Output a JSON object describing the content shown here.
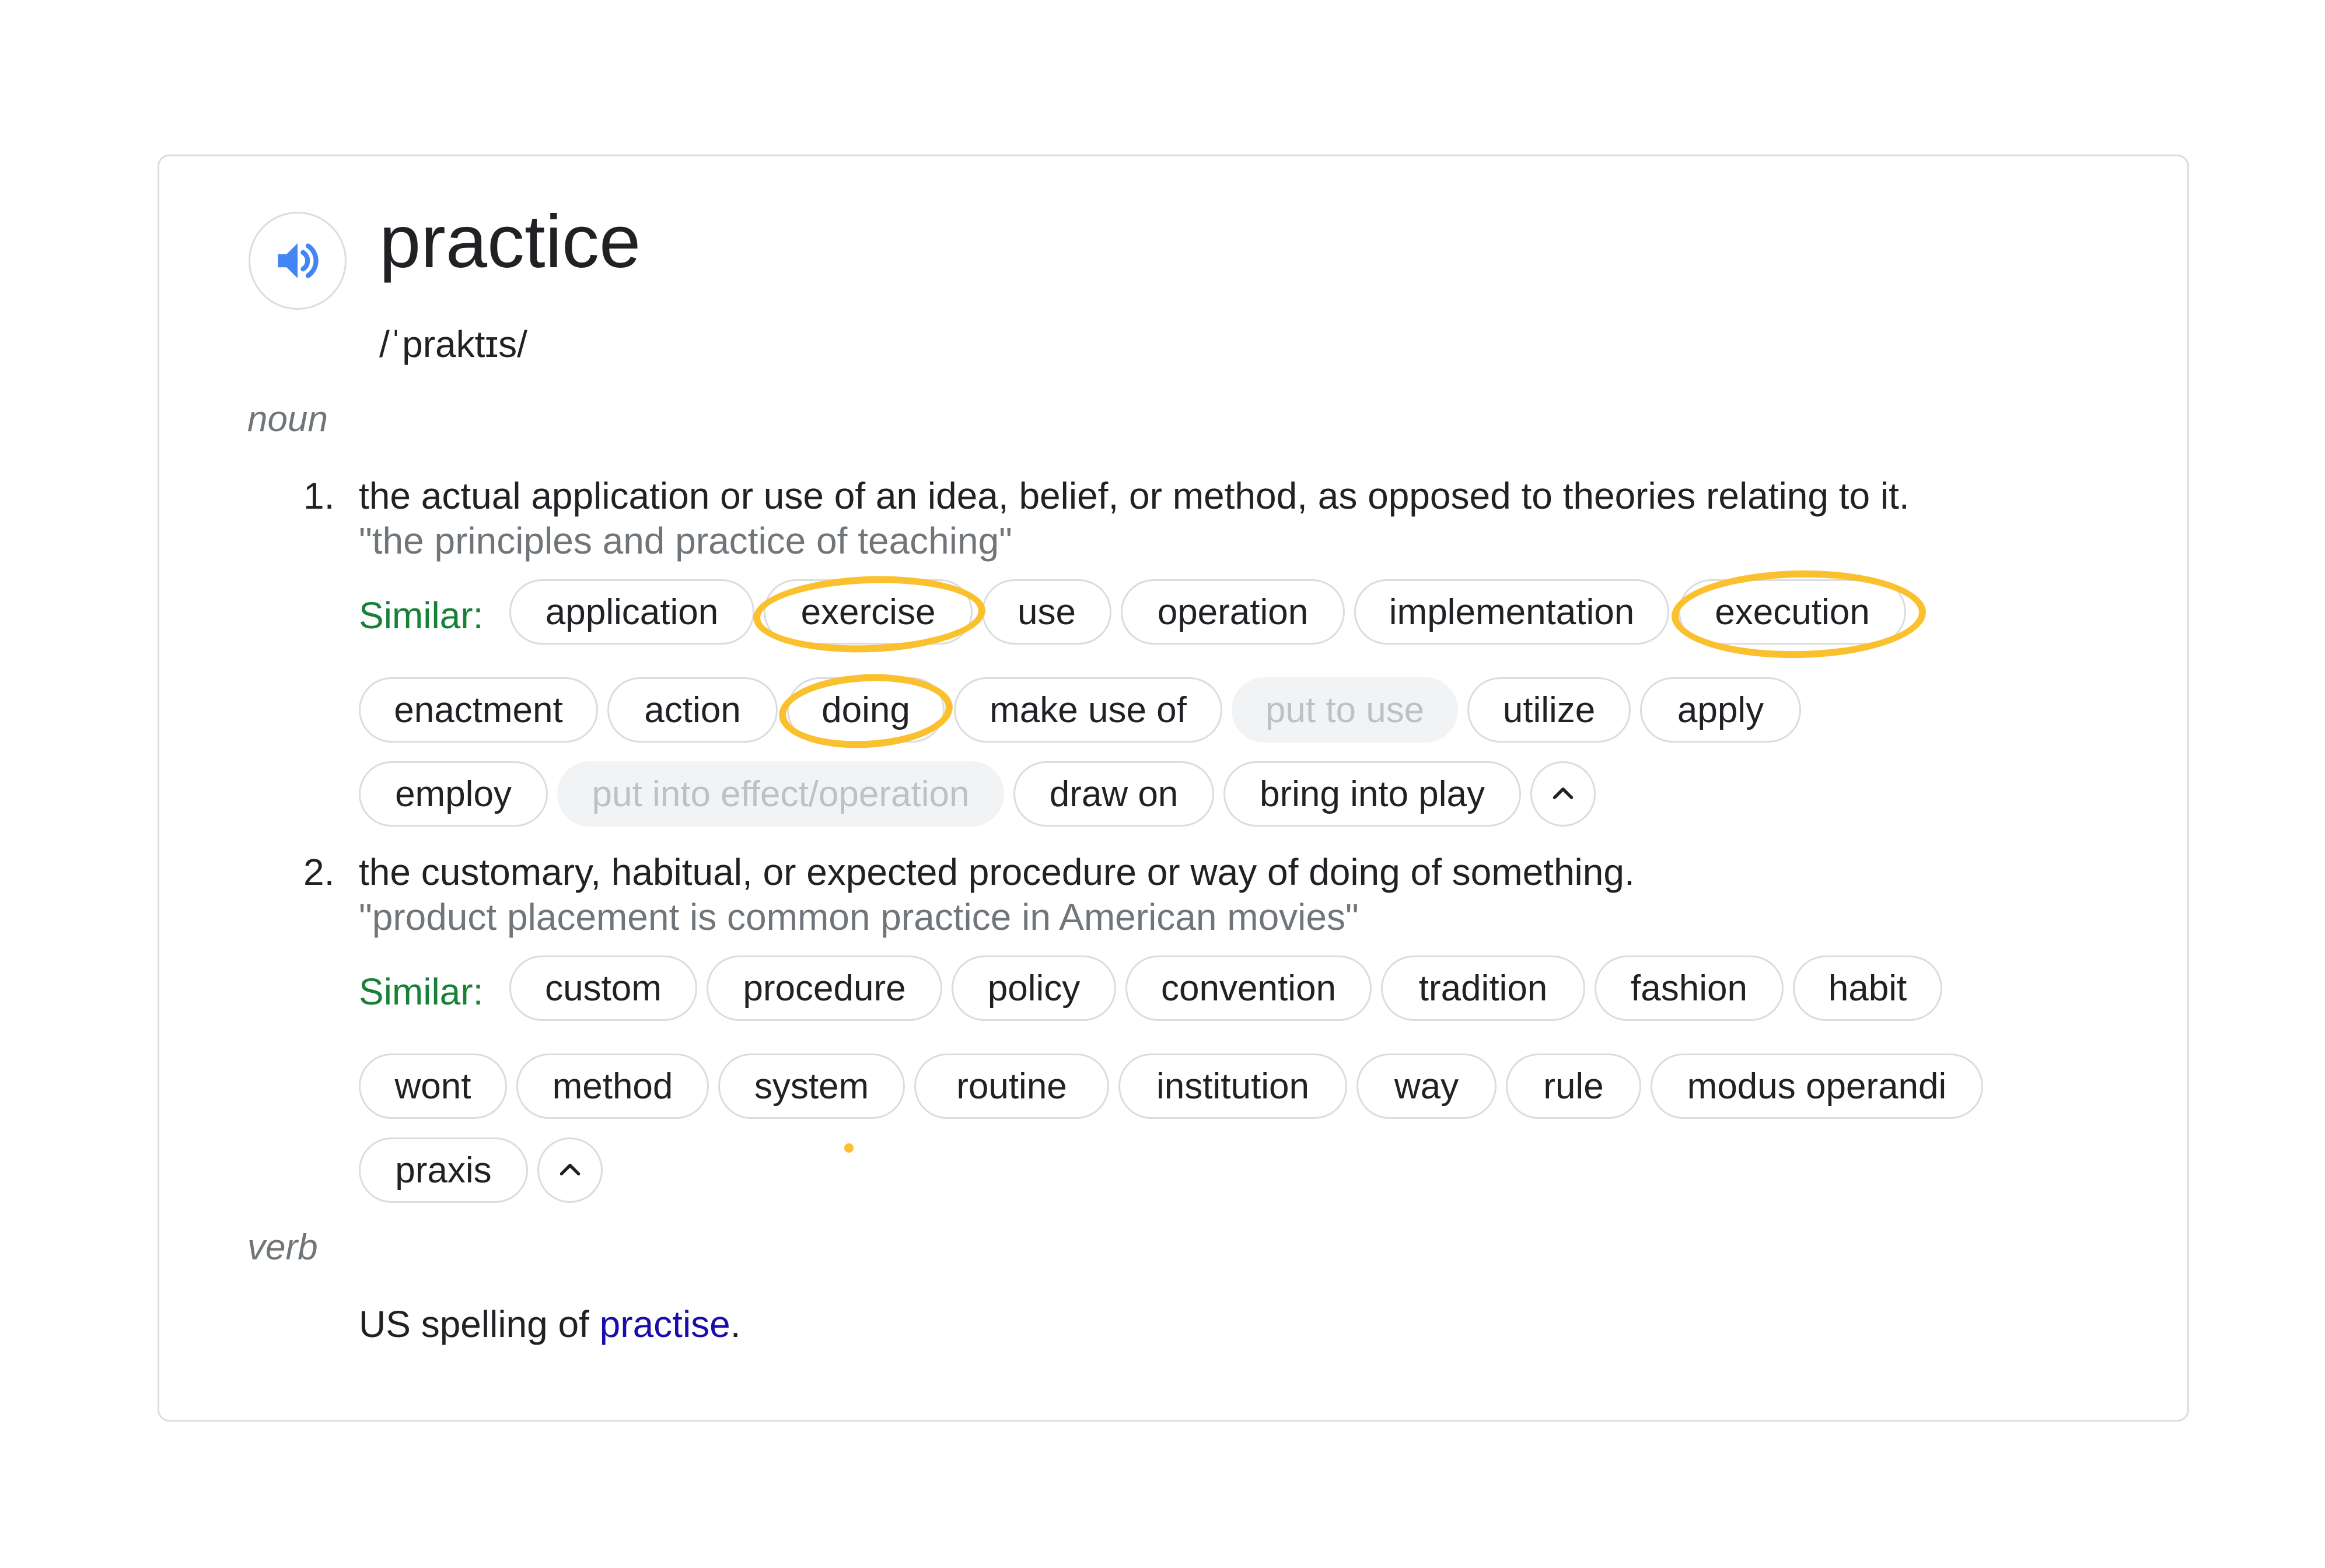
{
  "entry": {
    "word": "practice",
    "phonetic": "/ˈpraktɪs/",
    "speaker_icon": "volume-icon",
    "collapse_icon": "chevron-up-icon",
    "accent_color": "#4285f4",
    "similar_color": "#188038",
    "highlight_color": "#fbc02d"
  },
  "noun": {
    "label": "noun",
    "senses": [
      {
        "number": "1.",
        "definition": "the actual application or use of an idea, belief, or method, as opposed to theories relating to it.",
        "example": "\"the principles and practice of teaching\"",
        "similar_label": "Similar:",
        "synonyms": [
          "application",
          "exercise",
          "use",
          "operation",
          "implementation",
          "execution",
          "enactment",
          "action",
          "doing",
          "make use of",
          "put to use",
          "utilize",
          "apply",
          "employ",
          "put into effect/operation",
          "draw on",
          "bring into play"
        ]
      },
      {
        "number": "2.",
        "definition": "the customary, habitual, or expected procedure or way of doing of something.",
        "example": "\"product placement is common practice in American movies\"",
        "similar_label": "Similar:",
        "synonyms": [
          "custom",
          "procedure",
          "policy",
          "convention",
          "tradition",
          "fashion",
          "habit",
          "wont",
          "method",
          "system",
          "routine",
          "institution",
          "way",
          "rule",
          "modus operandi",
          "praxis"
        ]
      }
    ]
  },
  "verb": {
    "label": "verb",
    "text": "US spelling of ",
    "link": "practise",
    "suffix": "."
  }
}
